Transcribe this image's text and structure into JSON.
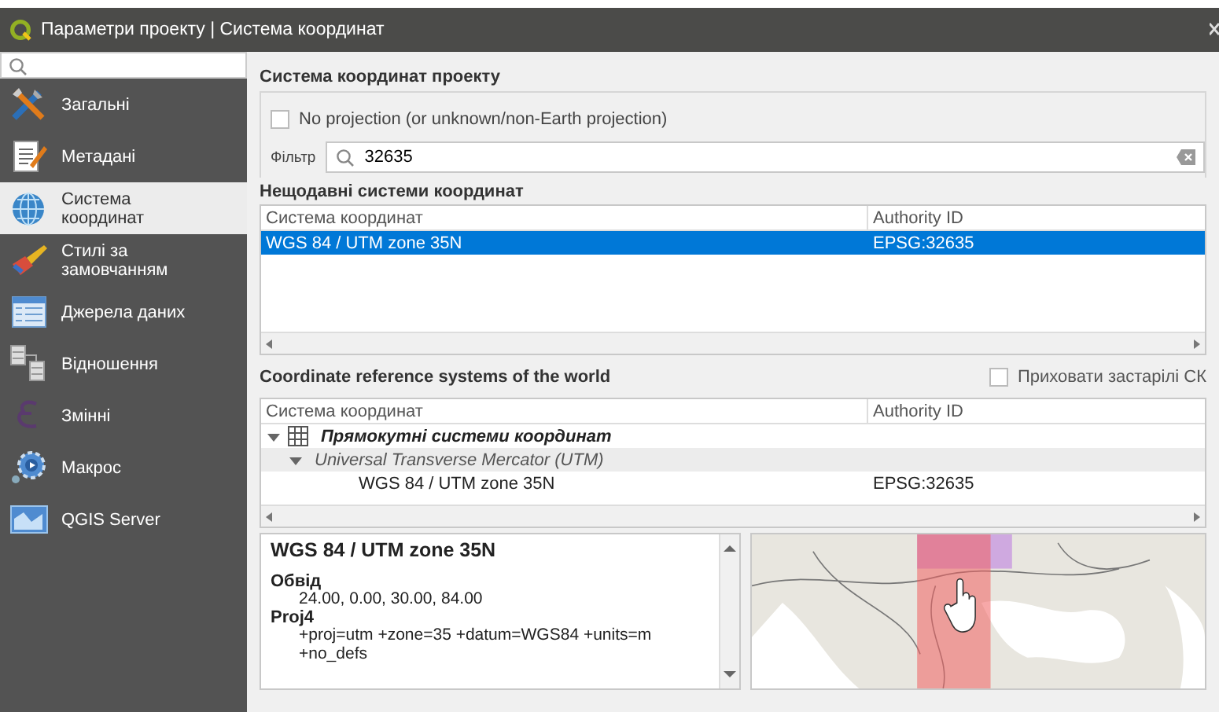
{
  "window": {
    "title": "Параметри проекту | Система координат"
  },
  "sidebar": {
    "items": [
      {
        "label": "Загальні",
        "selected": false
      },
      {
        "label": "Метадані",
        "selected": false
      },
      {
        "label": "Система координат",
        "selected": true
      },
      {
        "label": "Стилі за замовчанням",
        "selected": false
      },
      {
        "label": "Джерела даних",
        "selected": false
      },
      {
        "label": "Відношення",
        "selected": false
      },
      {
        "label": "Змінні",
        "selected": false
      },
      {
        "label": "Макрос",
        "selected": false
      },
      {
        "label": "QGIS Server",
        "selected": false
      }
    ]
  },
  "project_crs": {
    "title": "Система координат проекту",
    "no_projection": {
      "label": "No projection (or unknown/non-Earth projection)",
      "checked": false
    },
    "filter": {
      "label": "Фільтр",
      "value": "32635"
    },
    "recent": {
      "title": "Нещодавні системи координат",
      "columns": [
        "Система координат",
        "Authority ID"
      ],
      "rows": [
        {
          "cells": [
            "WGS 84 / UTM zone 35N",
            "EPSG:32635"
          ],
          "selected": true
        }
      ]
    }
  },
  "world": {
    "title": "Coordinate reference systems of the world",
    "hide_deprecated": {
      "label": "Приховати застарілі СК",
      "checked": false
    },
    "columns": [
      "Система координат",
      "Authority ID"
    ],
    "tree": [
      {
        "label": "Прямокутні системи координат",
        "expanded": true,
        "children": [
          {
            "label": "Universal Transverse Mercator (UTM)",
            "expanded": true,
            "children": [
              {
                "cells": [
                  "WGS 84 / UTM zone 35N",
                  "EPSG:32635"
                ],
                "selected": false
              }
            ]
          }
        ]
      }
    ]
  },
  "details": {
    "title": "WGS 84 / UTM zone 35N",
    "sections": [
      {
        "heading": "Обвід",
        "lines": [
          "24.00, 0.00, 30.00, 84.00"
        ]
      },
      {
        "heading": "Proj4",
        "lines": [
          "+proj=utm +zone=35 +datum=WGS84 +units=m",
          "+no_defs"
        ]
      }
    ]
  }
}
